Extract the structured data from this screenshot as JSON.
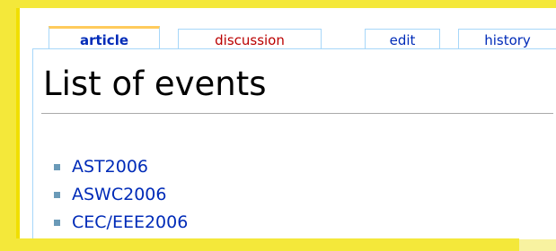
{
  "tabs": {
    "article": "article",
    "discussion": "discussion",
    "edit": "edit",
    "history": "history"
  },
  "page": {
    "title": "List of events"
  },
  "events": [
    "AST2006",
    "ASWC2006",
    "CEC/EEE2006"
  ]
}
